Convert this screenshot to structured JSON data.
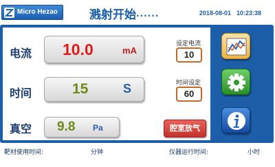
{
  "header": {
    "brand_name": "Micro Hezao",
    "status_text": "溅射开始",
    "status_dots": "······",
    "date": "2018-08-01",
    "time": "10:23:38"
  },
  "parameters": {
    "current": {
      "label": "电流",
      "value": "10.0",
      "unit": "mA",
      "set_label": "设定电流",
      "set_value": "10"
    },
    "time": {
      "label": "时间",
      "value": "15",
      "unit": "S",
      "set_label": "时间设定",
      "set_value": "60"
    },
    "vacuum": {
      "label": "真空",
      "value": "9.8",
      "unit": "Pa"
    }
  },
  "buttons": {
    "vent_label": "腔室放气",
    "chart_icon": "line-chart-icon",
    "settings_icon": "gear-icon",
    "info_icon": "info-icon"
  },
  "footer": {
    "target_time_label": "靶材使用时间:",
    "target_time_unit": "分钟",
    "runtime_label": "仪器运行时间:",
    "runtime_unit": "小时"
  },
  "colors": {
    "frame_blue": "#1c5fa8",
    "current_value": "#e01b1b",
    "time_value": "#6e8a1c",
    "vacuum_value": "#6e8a1c",
    "vent_button": "#c1312a",
    "chart_button": "#f2c15a",
    "settings_button": "#3ea33a",
    "info_button": "#1f63c2"
  }
}
